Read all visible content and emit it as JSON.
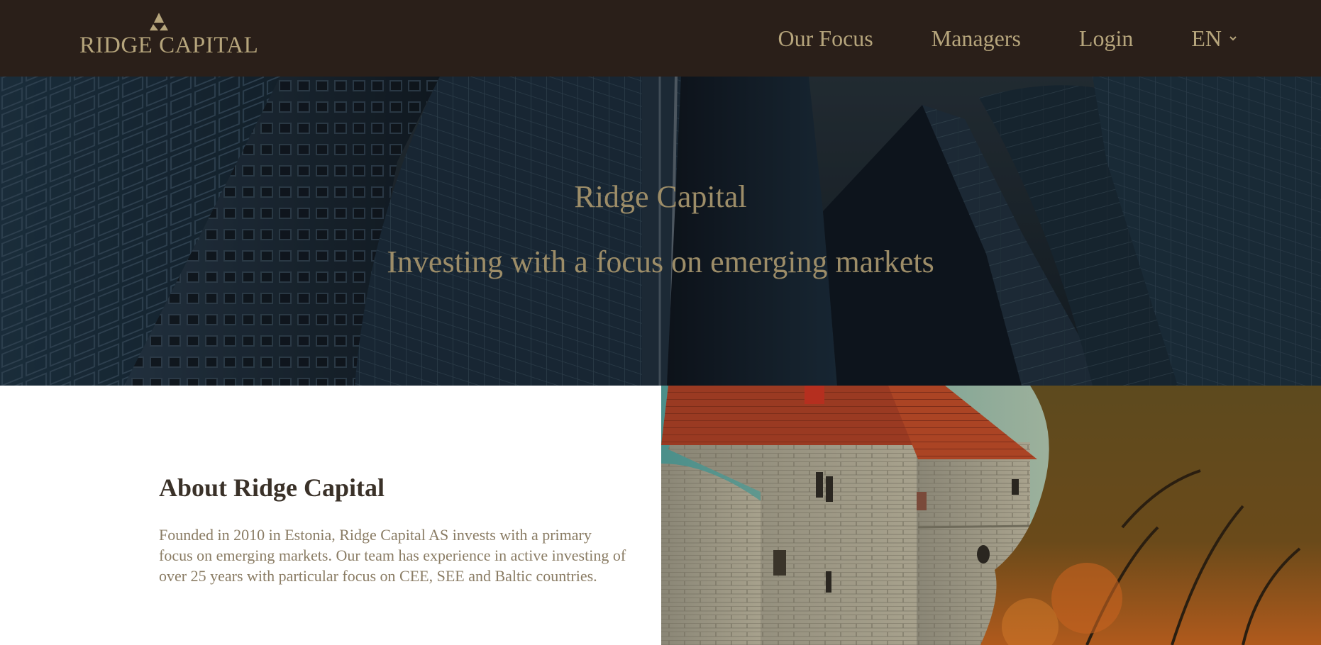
{
  "header": {
    "logo_text": "RIDGE CAPITAL",
    "nav": [
      {
        "label": "Our Focus"
      },
      {
        "label": "Managers"
      },
      {
        "label": "Login"
      }
    ],
    "language": "EN"
  },
  "hero": {
    "title": "Ridge Capital",
    "subtitle": "Investing with a focus on emerging markets"
  },
  "about": {
    "title": "About Ridge Capital",
    "body": "Founded in 2010 in Estonia, Ridge Capital AS invests with a primary focus on emerging markets. Our team has experience in active investing of over 25 years with particular focus on CEE, SEE and Baltic countries."
  },
  "colors": {
    "header_bg": "#2a1f19",
    "accent_gold": "#b6a57c",
    "hero_text": "#9d8d68",
    "about_title": "#3a3128",
    "about_body": "#8a7c64"
  },
  "icons": {
    "logo_mark": "mountain-peak-icon",
    "language_dropdown": "chevron-down-icon"
  }
}
